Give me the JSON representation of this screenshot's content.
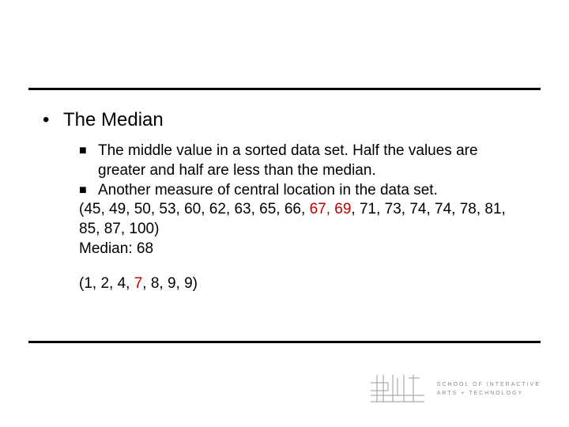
{
  "heading": "The Median",
  "points": {
    "a": "The middle value in a sorted data set. Half the values are greater and half are less than the median.",
    "b": "Another measure of central location in the data set."
  },
  "dataset1": {
    "pre": "(45, 49, 50, 53, 60, 62, 63, 65, 66, ",
    "mid": "67, 69",
    "post": ", 71, 73, 74, 74, 78, 81, 85, 87, 100)"
  },
  "median_line": "Median: 68",
  "dataset2": {
    "pre": "(1, 2, 4, ",
    "mid": "7",
    "post": ", 8, 9, 9)"
  },
  "footer_text_l1": "SCHOOL OF INTERACTIVE",
  "footer_text_l2": "ARTS + TECHNOLOGY"
}
